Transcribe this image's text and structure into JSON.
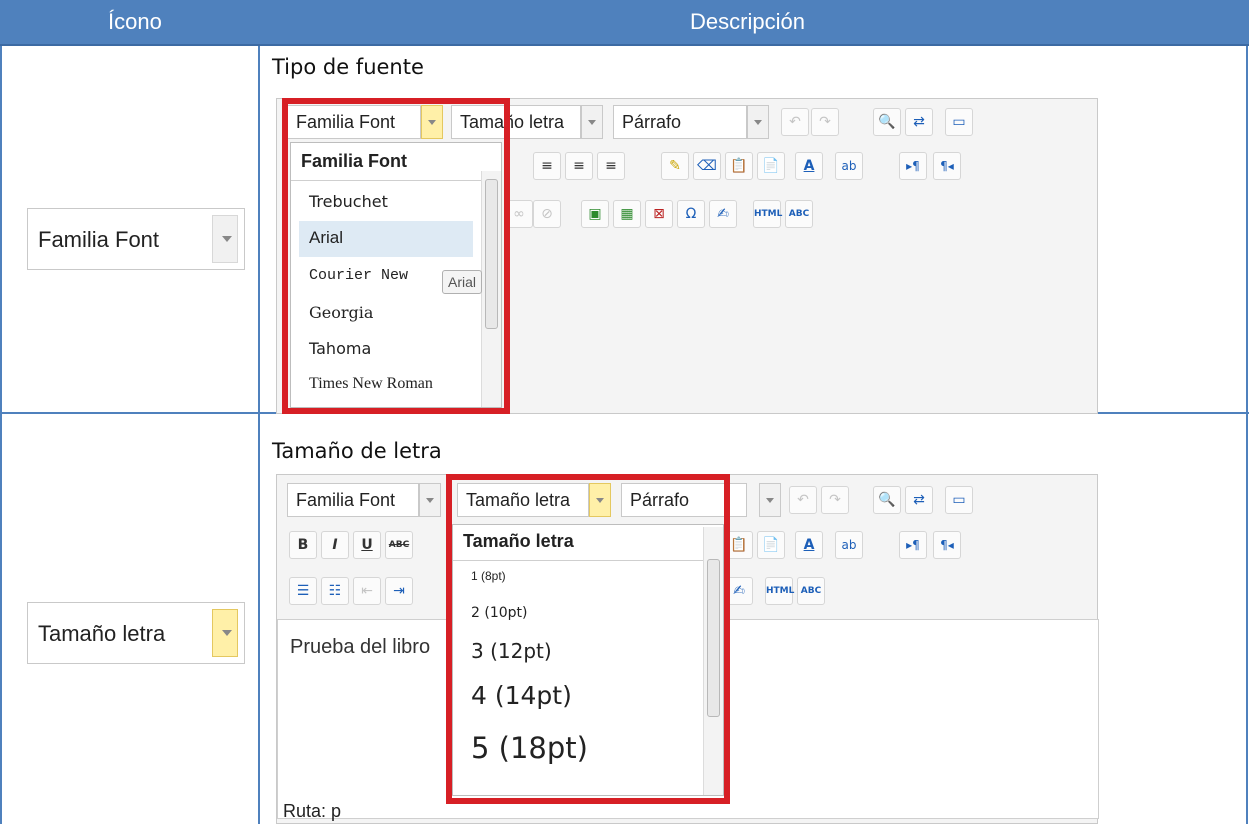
{
  "header": {
    "col_icon": "Ícono",
    "col_desc": "Descripción"
  },
  "row1": {
    "title": "Tipo de fuente",
    "icon_label": "Familia Font",
    "toolbar": {
      "font_select": "Familia Font",
      "size_select": "Tamaño letra",
      "format_select": "Párrafo"
    },
    "dropdown": {
      "header": "Familia Font",
      "options": [
        "Trebuchet",
        "Arial",
        "Courier New",
        "Georgia",
        "Tahoma",
        "Times New Roman"
      ],
      "highlighted": "Arial",
      "tooltip": "Arial"
    }
  },
  "row2": {
    "title": "Tamaño de letra",
    "icon_label": "Tamaño letra",
    "toolbar": {
      "font_select": "Familia Font",
      "size_select": "Tamaño letra",
      "format_select": "Párrafo"
    },
    "editor_text": "Prueba del libro",
    "dropdown": {
      "header": "Tamaño letra",
      "options": [
        "1 (8pt)",
        "2 (10pt)",
        "3 (12pt)",
        "4 (14pt)",
        "5 (18pt)"
      ]
    },
    "status": "Ruta: p"
  },
  "icons": {
    "undo": "↶",
    "redo": "↷",
    "find": "🔍",
    "replace": "⇄",
    "fullscreen": "▭",
    "bold": "B",
    "italic": "I",
    "underline": "U",
    "strike": "ABC",
    "list_ul": "☰",
    "list_ol": "☷",
    "outdent": "⇤",
    "indent": "⇥",
    "align_left": "≡",
    "align_center": "≡",
    "align_right": "≡",
    "paint": "✎",
    "erase": "⌫",
    "paste_text": "📋",
    "paste_word": "📄",
    "font_color": "A",
    "highlight": "ab",
    "ltr": "▸¶",
    "rtl": "¶◂",
    "image": "▣",
    "media": "▦",
    "nonbreaking": "⊠",
    "omega": "Ω",
    "edit": "✍",
    "html": "HTML",
    "spell": "ABC",
    "link": "∞",
    "unlink": "⊘"
  }
}
